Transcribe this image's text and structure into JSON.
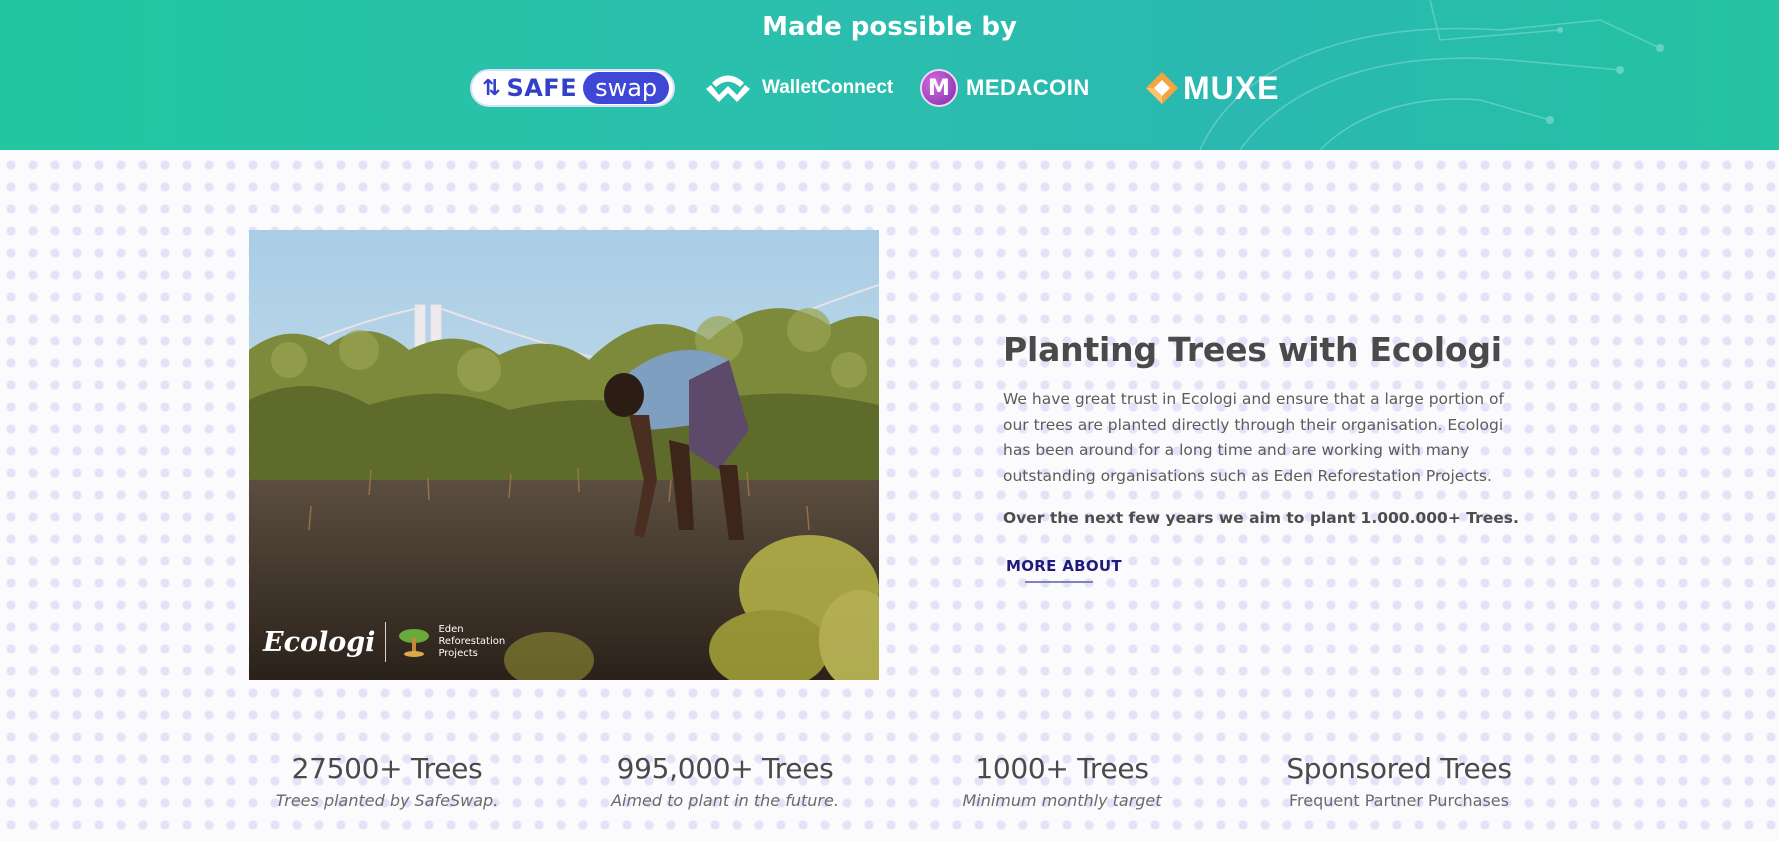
{
  "banner": {
    "title": "Made possible by",
    "background": "#25c3a4",
    "sponsors": [
      {
        "name": "SafeSwap",
        "safe": "SAFE",
        "swap": "swap",
        "icon": "safeswap-logo-icon",
        "color": "#3340c8"
      },
      {
        "name": "WalletConnect",
        "text": "WalletConnect",
        "icon": "walletconnect-logo-icon"
      },
      {
        "name": "Medacoin",
        "letter": "M",
        "text": "MEDACOIN",
        "icon": "medacoin-logo-icon",
        "color": "#9b3fc0"
      },
      {
        "name": "Muxe",
        "text": "MUXE",
        "icon": "muxe-logo-icon",
        "color": "#f4a53b"
      }
    ]
  },
  "feature": {
    "photo": {
      "brand_ecologi": "Ecologi",
      "brand_eden_lines": [
        "Eden",
        "Reforestation",
        "Projects"
      ]
    },
    "heading": "Planting Trees with Ecologi",
    "paragraph": "We have great trust in Ecologi and ensure that a large portion of our trees are planted directly through their organisation. Ecologi has been around for a long time and are working with many outstanding organisations such as Eden Reforestation Projects.",
    "strong_line": "Over the next few years we aim to plant 1.000.000+ Trees.",
    "more_label": "MORE ABOUT",
    "link_color": "#1f1b7a"
  },
  "stats": [
    {
      "title": "27500+ Trees",
      "caption": "Trees planted by SafeSwap."
    },
    {
      "title": "995,000+ Trees",
      "caption": "Aimed to plant in the future."
    },
    {
      "title": "1000+ Trees",
      "caption": "Minimum monthly target"
    },
    {
      "title": "Sponsored Trees",
      "caption": "Frequent Partner Purchases"
    }
  ]
}
